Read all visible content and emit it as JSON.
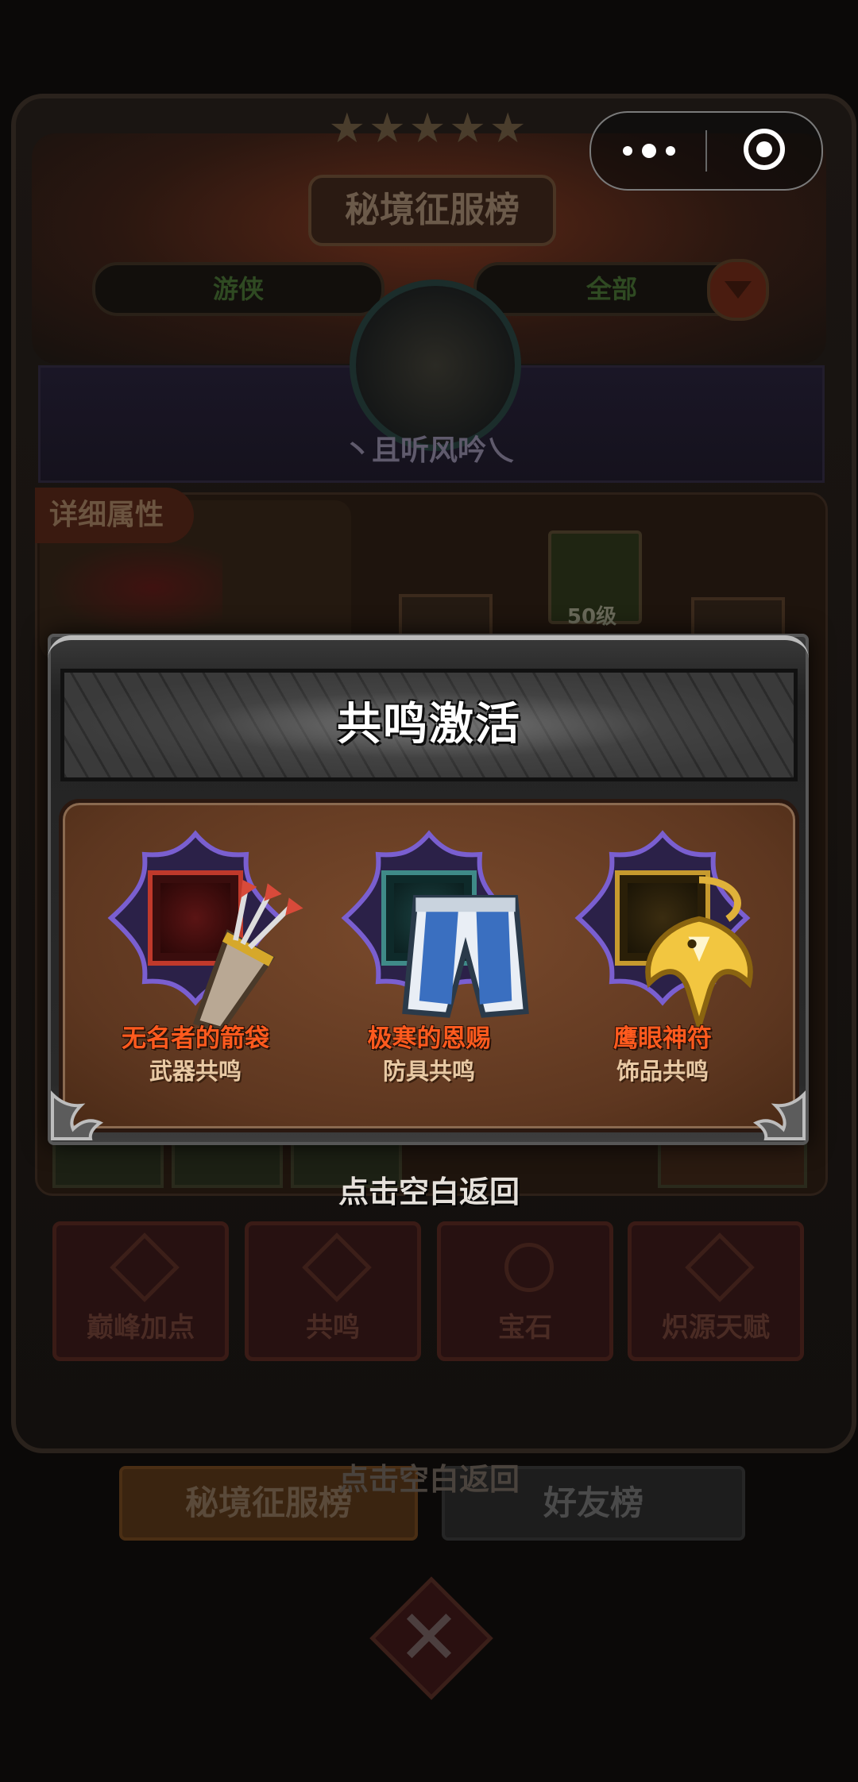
{
  "background": {
    "title": "秘境征服榜",
    "tab_class": "游侠",
    "tab_filter": "全部",
    "player_name": "丶且听风吟乀",
    "detail_tag": "详细属性",
    "level_badge": "50级",
    "bottom_buttons": [
      "巅峰加点",
      "共鸣",
      "宝石",
      "炽源天赋"
    ],
    "hint_back": "点击空白返回",
    "rank_tabs": [
      "秘境征服榜",
      "好友榜"
    ]
  },
  "capsule": {
    "more_icon": "more-dots-icon",
    "close_icon": "target-circle-icon"
  },
  "modal": {
    "title": "共鸣激活",
    "items": [
      {
        "name": "无名者的箭袋",
        "type": "武器共鸣",
        "icon": "quiver-icon",
        "color": "#c0392b"
      },
      {
        "name": "极寒的恩赐",
        "type": "防具共鸣",
        "icon": "pants-icon",
        "color": "#3f8a88"
      },
      {
        "name": "鹰眼神符",
        "type": "饰品共鸣",
        "icon": "eagle-amulet-icon",
        "color": "#c69a2e"
      }
    ]
  },
  "hint": "点击空白返回"
}
